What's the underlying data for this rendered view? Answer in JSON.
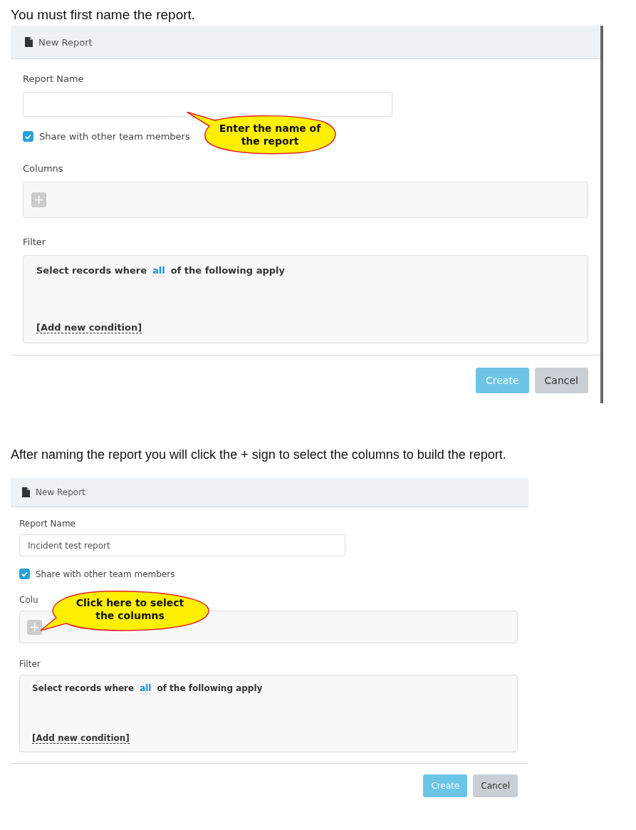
{
  "sections": [
    {
      "caption": "You must first name the report.",
      "dialog": {
        "title": "New Report",
        "report_name": {
          "label": "Report Name"
        },
        "share": {
          "label": "Share with other team members",
          "checked": true
        },
        "columns": {
          "label": "Columns",
          "add": "+"
        },
        "filter": {
          "label": "Filter",
          "sentence_before": "Select records where",
          "mode": "all",
          "sentence_after": "of the following apply",
          "add_condition": "[Add new condition]"
        },
        "buttons": [
          {
            "label": "Create",
            "kind": "primary"
          },
          {
            "label": "Cancel",
            "kind": "secondary"
          }
        ]
      },
      "callout": {
        "text": "Enter the name of the report"
      }
    },
    {
      "caption": "After naming the report you will click the + sign to select the columns to build the report.",
      "dialog": {
        "title": "New Report",
        "report_name": {
          "label": "Report Name",
          "value": "Incident test report"
        },
        "share": {
          "label": "Share with other team members",
          "checked": true
        },
        "columns": {
          "label": "Colu",
          "add": "+"
        },
        "filter": {
          "label": "Filter",
          "sentence_before": "Select records where",
          "mode": "all",
          "sentence_after": "of the following apply",
          "add_condition": "[Add new condition]"
        },
        "buttons": [
          {
            "label": "Create",
            "kind": "primary"
          },
          {
            "label": "Cancel",
            "kind": "secondary"
          }
        ]
      },
      "callout": {
        "text": "Click here to select the columns"
      }
    }
  ]
}
